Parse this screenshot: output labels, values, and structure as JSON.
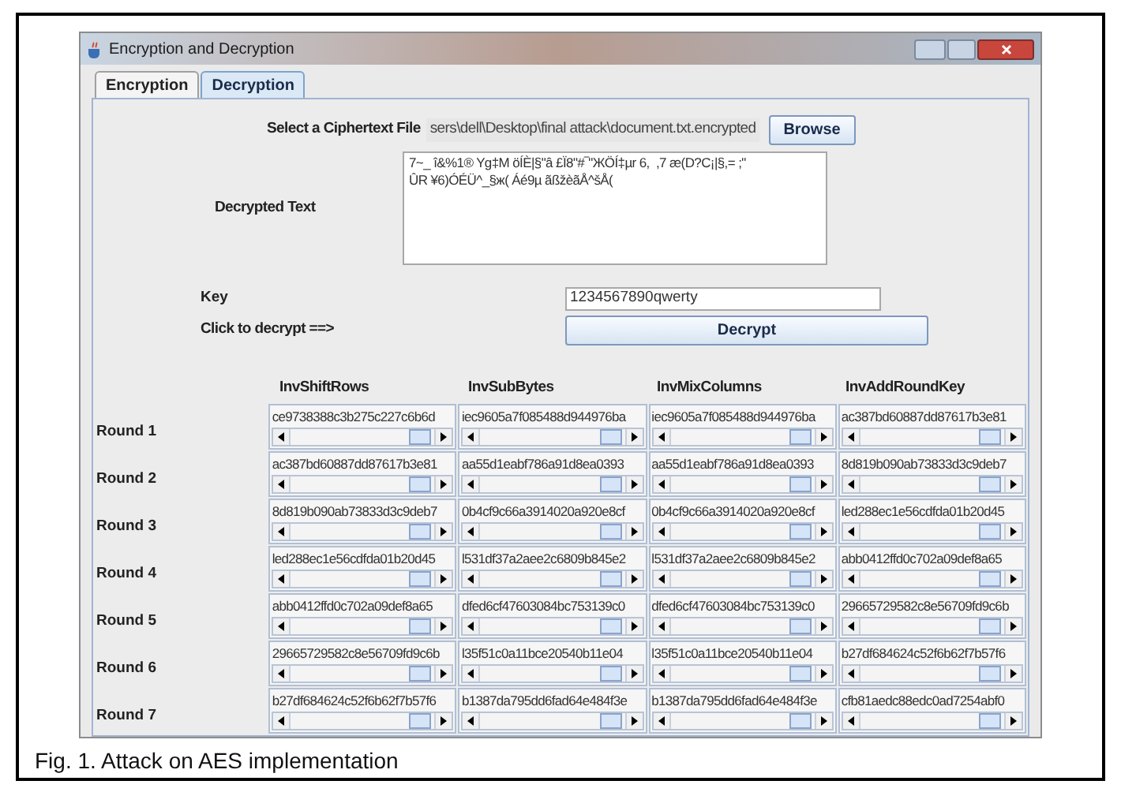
{
  "window": {
    "title": "Encryption and Decryption"
  },
  "tabs": [
    {
      "label": "Encryption",
      "selected": false
    },
    {
      "label": "Decryption",
      "selected": true
    }
  ],
  "file": {
    "label": "Select a Ciphertext File",
    "path": "sers\\dell\\Desktop\\final attack\\document.txt.encrypted",
    "button": "Browse"
  },
  "decrypted": {
    "label": "Decrypted Text",
    "lines": [
      "7~_ î&%1® Yg‡M öÍÈ|§\"â £Ï8\"#‾\"ЖÖÍ‡µr 6,  ,7 æ(D?C¡|§,= ;\"",
      "ÛR ¥6)ÓÉÜ^_§ж( Áé9µ ãßžèãÅ^šÅ("
    ]
  },
  "key": {
    "label": "Key",
    "value": "1234567890qwerty"
  },
  "decrypt": {
    "label": "Click to decrypt ==>",
    "button": "Decrypt"
  },
  "columns": [
    "InvShiftRows",
    "InvSubBytes",
    "InvMixColumns",
    "InvAddRoundKey"
  ],
  "rounds": [
    {
      "label": "Round 1",
      "values": [
        "ce9738388c3b275c227c6b6d",
        "iec9605a7f085488d944976ba",
        "iec9605a7f085488d944976ba",
        "ac387bd60887dd87617b3e81"
      ]
    },
    {
      "label": "Round 2",
      "values": [
        "ac387bd60887dd87617b3e81",
        "aa55d1eabf786a91d8ea0393",
        "aa55d1eabf786a91d8ea0393",
        "8d819b090ab73833d3c9deb7"
      ]
    },
    {
      "label": "Round 3",
      "values": [
        "8d819b090ab73833d3c9deb7",
        "0b4cf9c66a3914020a920e8cf",
        "0b4cf9c66a3914020a920e8cf",
        "led288ec1e56cdfda01b20d45"
      ]
    },
    {
      "label": "Round 4",
      "values": [
        "led288ec1e56cdfda01b20d45",
        "l531df37a2aee2c6809b845e2",
        "l531df37a2aee2c6809b845e2",
        "abb0412ffd0c702a09def8a65"
      ]
    },
    {
      "label": "Round 5",
      "values": [
        "abb0412ffd0c702a09def8a65",
        "dfed6cf47603084bc753139c0",
        "dfed6cf47603084bc753139c0",
        "29665729582c8e56709fd9c6b"
      ]
    },
    {
      "label": "Round 6",
      "values": [
        "29665729582c8e56709fd9c6b",
        "l35f51c0a11bce20540b11e04",
        "l35f51c0a11bce20540b11e04",
        "b27df684624c52f6b62f7b57f6"
      ]
    },
    {
      "label": "Round 7",
      "values": [
        "b27df684624c52f6b62f7b57f6",
        "b1387da795dd6fad64e484f3e",
        "b1387da795dd6fad64e484f3e",
        "cfb81aedc88edc0ad7254abf0"
      ]
    }
  ],
  "caption": "Fig. 1. Attack on AES implementation"
}
